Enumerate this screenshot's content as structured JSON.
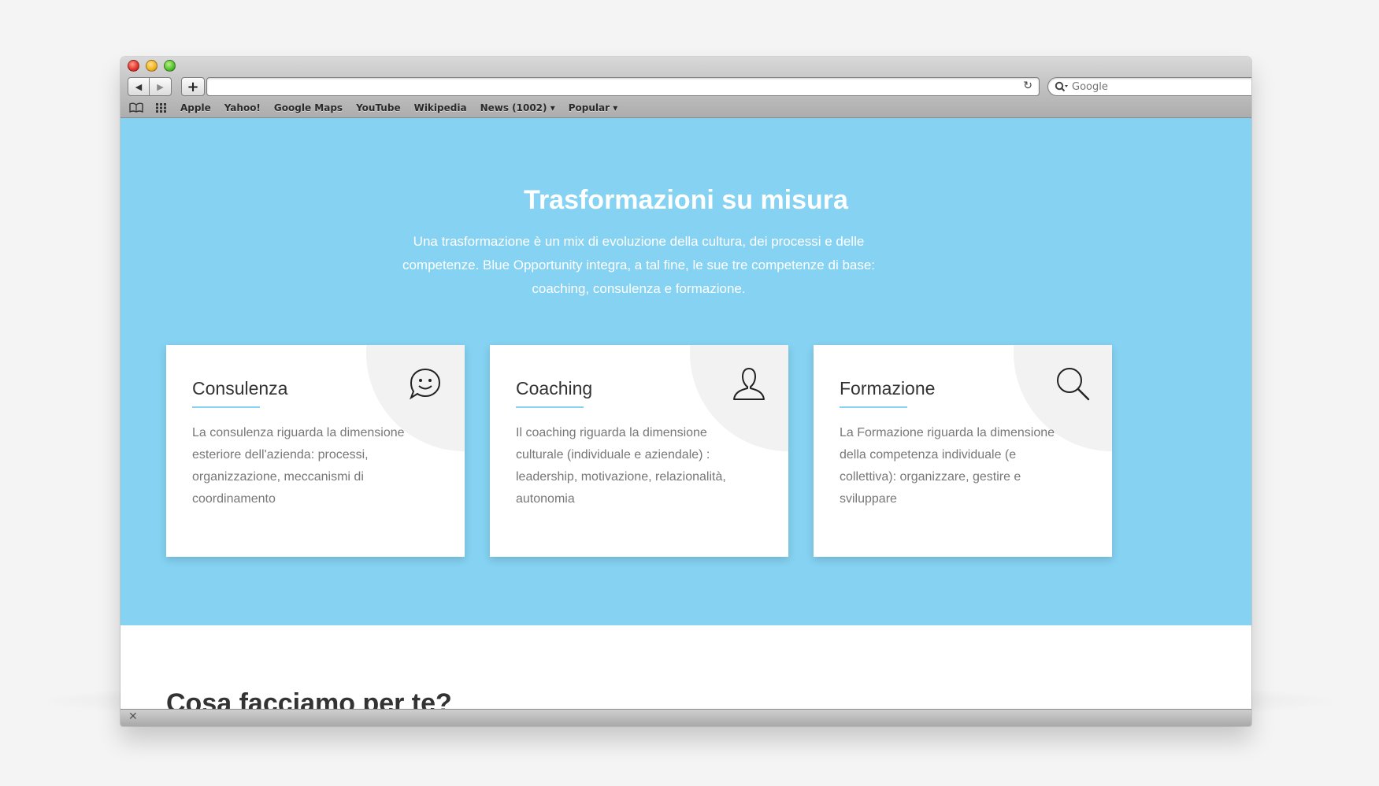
{
  "browser": {
    "search_placeholder": "Google",
    "bookmarks": [
      "Apple",
      "Yahoo!",
      "Google Maps",
      "YouTube",
      "Wikipedia",
      "News (1002) ▾",
      "Popular ▾"
    ]
  },
  "hero": {
    "title": "Trasformazioni su misura",
    "subtitle": "Una trasformazione è un mix di evoluzione della cultura, dei processi e delle competenze. Blue Opportunity integra, a tal fine, le sue tre competenze di base: coaching, consulenza e formazione.",
    "background": "#85d2f2"
  },
  "cards": [
    {
      "title": "Consulenza",
      "icon": "speech-smiley-icon",
      "text": "La consulenza riguarda la dimensione esteriore dell'azienda: processi, organizzazione, meccanismi di coordinamento"
    },
    {
      "title": "Coaching",
      "icon": "person-icon",
      "text": "Il coaching riguarda la dimensione culturale (individuale e aziendale) : leadership, motivazione, relazionalità, autonomia"
    },
    {
      "title": "Formazione",
      "icon": "magnifier-icon",
      "text": "La Formazione riguarda la dimensione della competenza individuale (e collettiva): organizzare, gestire e sviluppare"
    }
  ],
  "lower": {
    "title": "Cosa facciamo per te?"
  }
}
